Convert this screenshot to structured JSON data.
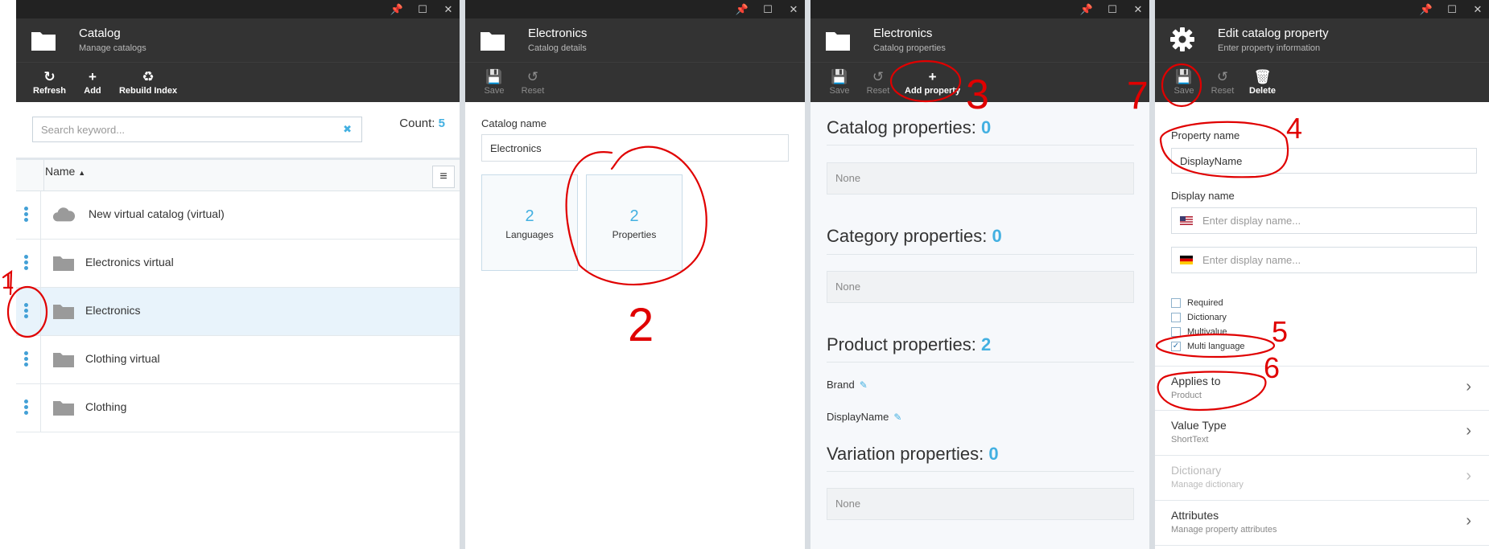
{
  "window_controls": {
    "pin": "📌",
    "maximize": "☐",
    "close": "✕"
  },
  "blade1": {
    "title": "Catalog",
    "subtitle": "Manage catalogs",
    "toolbar": [
      {
        "label": "Refresh",
        "icon": "↻"
      },
      {
        "label": "Add",
        "icon": "+"
      },
      {
        "label": "Rebuild Index",
        "icon": "♻"
      }
    ],
    "search_placeholder": "Search keyword...",
    "clear_icon": "✖",
    "count_label": "Count:",
    "count_value": "5",
    "column_name": "Name",
    "sort_arrow": "▲",
    "grid_menu_icon": "≡",
    "rows": [
      {
        "label": "New virtual catalog (virtual)",
        "icon": "cloud-icon",
        "selected": false
      },
      {
        "label": "Electronics virtual",
        "icon": "folder-icon",
        "selected": false
      },
      {
        "label": "Electronics",
        "icon": "folder-icon",
        "selected": true
      },
      {
        "label": "Clothing virtual",
        "icon": "folder-icon",
        "selected": false
      },
      {
        "label": "Clothing",
        "icon": "folder-icon",
        "selected": false
      }
    ]
  },
  "blade2": {
    "title": "Electronics",
    "subtitle": "Catalog details",
    "toolbar": [
      {
        "label": "Save",
        "icon": "💾"
      },
      {
        "label": "Reset",
        "icon": "↺"
      }
    ],
    "catalog_name_label": "Catalog name",
    "catalog_name_value": "Electronics",
    "tiles": [
      {
        "count": "2",
        "label": "Languages"
      },
      {
        "count": "2",
        "label": "Properties"
      }
    ]
  },
  "blade3": {
    "title": "Electronics",
    "subtitle": "Catalog properties",
    "toolbar": [
      {
        "label": "Save",
        "icon": "💾"
      },
      {
        "label": "Reset",
        "icon": "↺"
      },
      {
        "label": "Add property",
        "icon": "+"
      }
    ],
    "sections": [
      {
        "title": "Catalog properties:",
        "count": "0",
        "none": "None"
      },
      {
        "title": "Category properties:",
        "count": "0",
        "none": "None"
      },
      {
        "title": "Product properties:",
        "count": "2",
        "items": [
          "Brand",
          "DisplayName"
        ]
      },
      {
        "title": "Variation properties:",
        "count": "0",
        "none": "None"
      }
    ],
    "edit_icon": "✎"
  },
  "blade4": {
    "title": "Edit catalog property",
    "subtitle": "Enter property information",
    "toolbar": [
      {
        "label": "Save",
        "icon": "💾"
      },
      {
        "label": "Reset",
        "icon": "↺"
      },
      {
        "label": "Delete",
        "icon": "🗑"
      }
    ],
    "property_name_label": "Property name",
    "property_name_value": "DisplayName",
    "display_name_label": "Display name",
    "display_name_placeholder": "Enter display name...",
    "checkboxes": [
      {
        "label": "Required",
        "checked": false
      },
      {
        "label": "Dictionary",
        "checked": false
      },
      {
        "label": "Multivalue",
        "checked": false
      },
      {
        "label": "Multi language",
        "checked": true
      }
    ],
    "check_mark": "✓",
    "nav_rows": [
      {
        "title": "Applies to",
        "subtitle": "Product",
        "disabled": false
      },
      {
        "title": "Value Type",
        "subtitle": "ShortText",
        "disabled": false
      },
      {
        "title": "Dictionary",
        "subtitle": "Manage dictionary",
        "disabled": true
      },
      {
        "title": "Attributes",
        "subtitle": "Manage property attributes",
        "disabled": false
      }
    ],
    "chevron": "›"
  },
  "annotations": [
    "1",
    "2",
    "3",
    "4",
    "5",
    "6",
    "7"
  ],
  "colors": {
    "accent": "#43b0e1",
    "header": "#333333",
    "annotation": "#e00000"
  }
}
